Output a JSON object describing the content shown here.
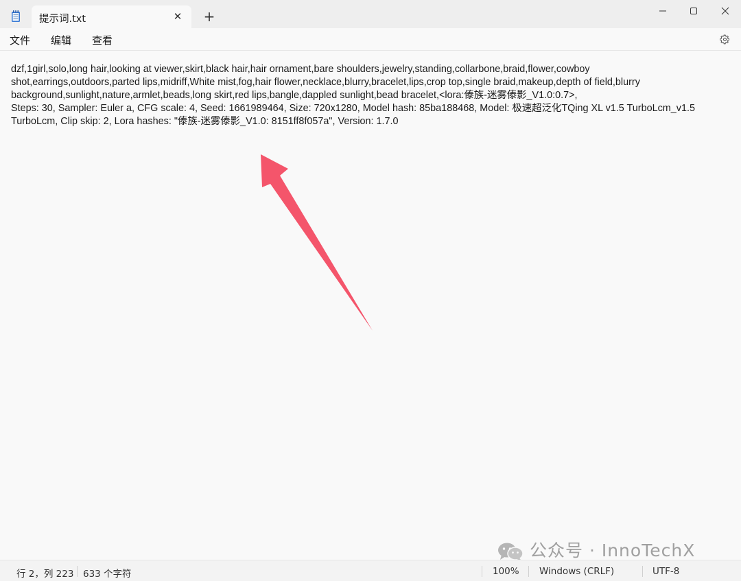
{
  "tab": {
    "title": "提示词.txt",
    "close_symbol": "✕",
    "new_tab_symbol": "+"
  },
  "menu": {
    "file": "文件",
    "edit": "编辑",
    "view": "查看"
  },
  "editor": {
    "content": "dzf,1girl,solo,long hair,looking at viewer,skirt,black hair,hair ornament,bare shoulders,jewelry,standing,collarbone,braid,flower,cowboy shot,earrings,outdoors,parted lips,midriff,White mist,fog,hair flower,necklace,blurry,bracelet,lips,crop top,single braid,makeup,depth of field,blurry background,sunlight,nature,armlet,beads,long skirt,red lips,bangle,dappled sunlight,bead bracelet,<lora:傣族-迷雾傣影_V1.0:0.7>,\nSteps: 30, Sampler: Euler a, CFG scale: 4, Seed: 1661989464, Size: 720x1280, Model hash: 85ba188468, Model: 极速超泛化TQing XL v1.5 TurboLcm_v1.5 TurboLcm, Clip skip: 2, Lora hashes: \"傣族-迷雾傣影_V1.0: 8151ff8f057a\", Version: 1.7.0"
  },
  "annotation": {
    "arrow_color": "#f4556b"
  },
  "watermark": {
    "text": "公众号 · InnoTechX"
  },
  "status": {
    "position": "行 2，列 223",
    "char_count": "633 个字符",
    "zoom": "100%",
    "line_ending": "Windows (CRLF)",
    "encoding": "UTF-8"
  },
  "icons": {
    "app": "notepad-icon",
    "settings": "gear-icon",
    "minimize": "minimize-icon",
    "maximize": "maximize-icon",
    "close": "close-icon",
    "watermark": "wechat-icon"
  }
}
